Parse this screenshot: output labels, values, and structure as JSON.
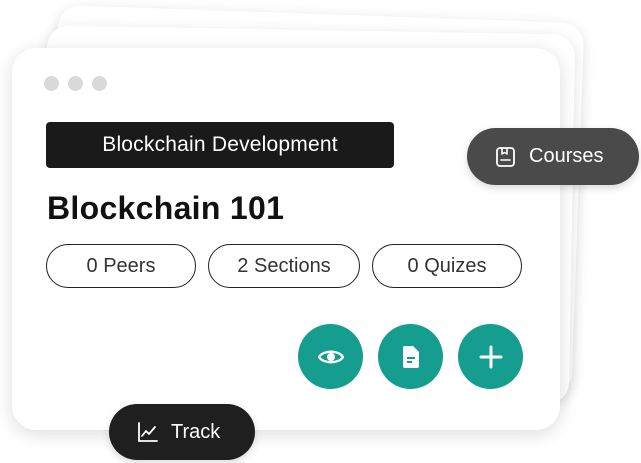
{
  "card": {
    "category": "Blockchain Development",
    "title": "Blockchain 101",
    "stats": [
      {
        "label": "0 Peers"
      },
      {
        "label": "2 Sections"
      },
      {
        "label": "0 Quizes"
      }
    ],
    "actions": [
      {
        "icon": "eye-icon"
      },
      {
        "icon": "document-icon"
      },
      {
        "icon": "plus-icon"
      }
    ]
  },
  "chips": {
    "courses": {
      "label": "Courses",
      "icon": "book-icon"
    },
    "track": {
      "label": "Track",
      "icon": "line-chart-icon"
    }
  },
  "colors": {
    "accent": "#159e8f",
    "tag_bg": "#1a1a1a",
    "courses_chip_bg": "#4a4a4a",
    "track_chip_bg": "#1f1f1f"
  }
}
